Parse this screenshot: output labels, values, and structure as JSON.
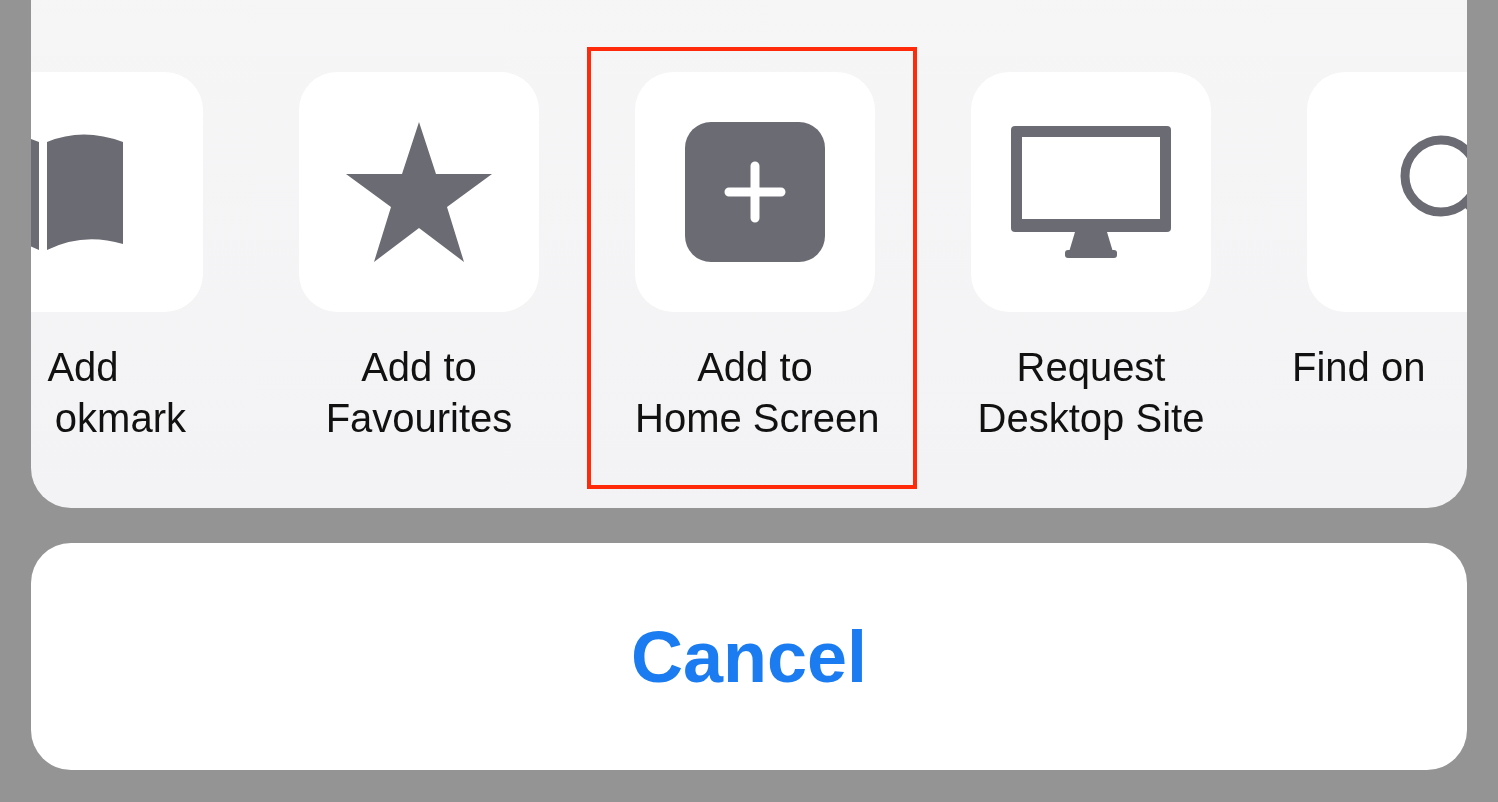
{
  "actions": [
    {
      "label": [
        "Add",
        "okmark"
      ],
      "highlighted": false
    },
    {
      "label": [
        "Add to",
        "Favourites"
      ],
      "highlighted": false
    },
    {
      "label": [
        "Add to",
        "Home Screen"
      ],
      "highlighted": true
    },
    {
      "label": [
        "Request",
        "Desktop Site"
      ],
      "highlighted": false
    },
    {
      "label": [
        "Find on"
      ],
      "highlighted": false
    }
  ],
  "cancel": {
    "label": "Cancel"
  }
}
